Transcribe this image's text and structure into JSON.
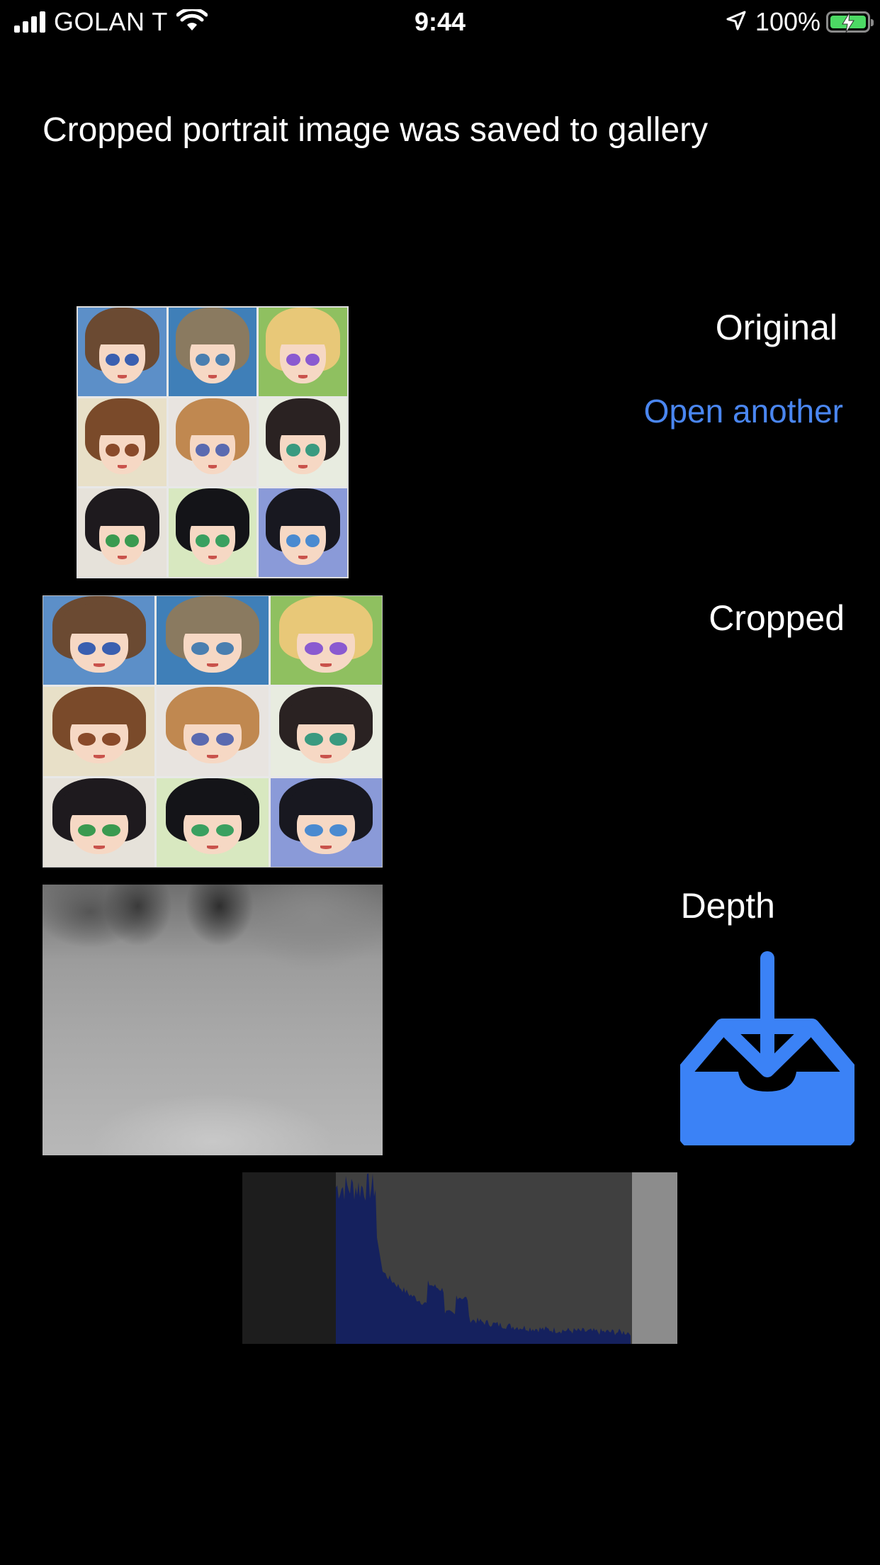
{
  "status_bar": {
    "carrier": "GOLAN T",
    "time": "9:44",
    "battery_percent": "100%",
    "battery_level": 1.0,
    "icons": [
      "cellular-signal-icon",
      "wifi-icon",
      "location-arrow-icon",
      "battery-charging-icon"
    ]
  },
  "message": "Cropped portrait image was saved to gallery",
  "labels": {
    "original": "Original",
    "cropped": "Cropped",
    "depth": "Depth"
  },
  "actions": {
    "open_another": "Open another",
    "save_icon": "tray-download-icon"
  },
  "colors": {
    "background": "#000000",
    "accent": "#4a86f0",
    "download_icon": "#3b82f6",
    "histogram_fill": "#15215e",
    "battery_fill": "#4cd964"
  },
  "portraits": [
    {
      "hair": "#6b4a32",
      "bg": "#5c8fc8",
      "eye": "#3a5fb0"
    },
    {
      "hair": "#8a7a60",
      "bg": "#3f7fb8",
      "eye": "#4a7fb0"
    },
    {
      "hair": "#e8c878",
      "bg": "#8fc060",
      "eye": "#8a5ad0"
    },
    {
      "hair": "#7a4a2a",
      "bg": "#e8e0c8",
      "eye": "#8a4a2a"
    },
    {
      "hair": "#c08850",
      "bg": "#e8e4e0",
      "eye": "#5a6ab0"
    },
    {
      "hair": "#2a2222",
      "bg": "#e8ece0",
      "eye": "#3a9a80"
    },
    {
      "hair": "#1e1a1e",
      "bg": "#e6e2da",
      "eye": "#3a9a50"
    },
    {
      "hair": "#141418",
      "bg": "#d8e8c0",
      "eye": "#3aa060"
    },
    {
      "hair": "#181820",
      "bg": "#8a9ad8",
      "eye": "#4a8ad0"
    }
  ]
}
